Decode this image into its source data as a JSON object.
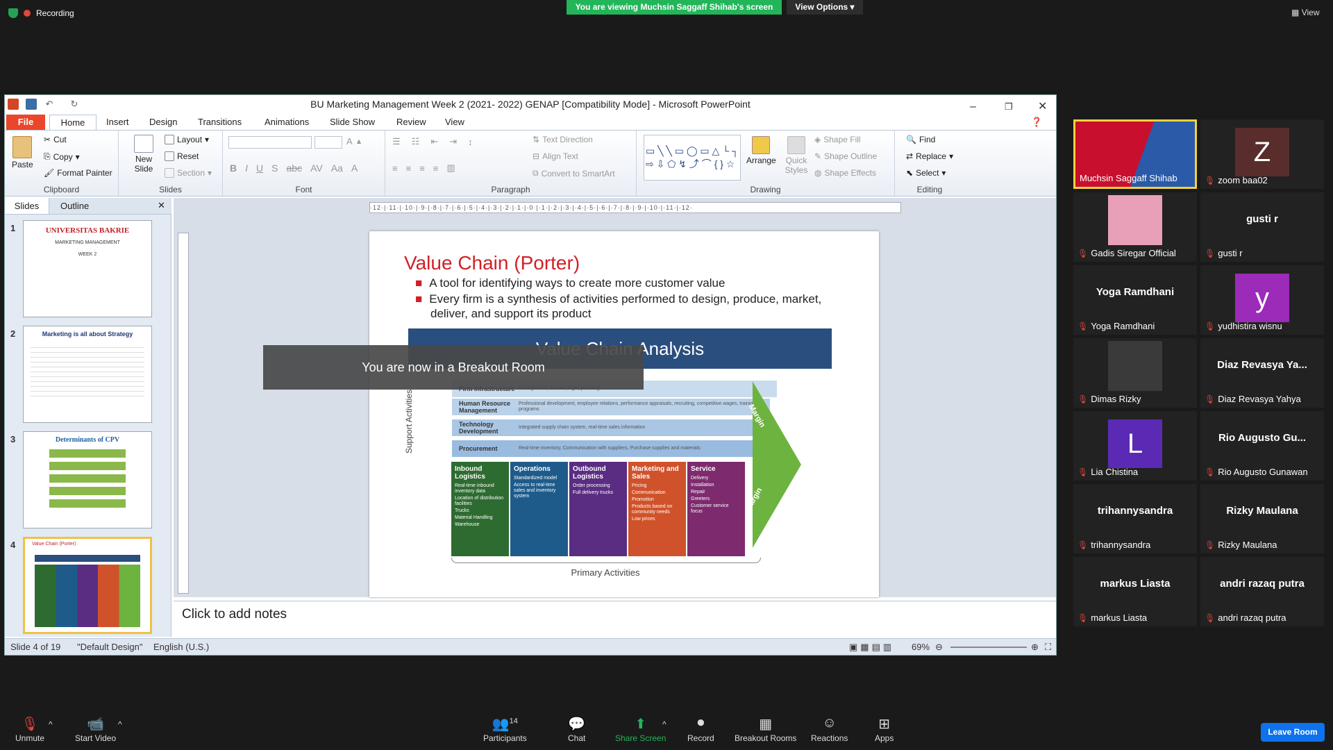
{
  "zoom_top": {
    "recording": "Recording",
    "viewing_banner": "You are viewing Muchsin Saggaff Shihab's screen",
    "view_options": "View Options",
    "view": "View"
  },
  "ppt": {
    "title": "BU Marketing Management Week 2 (2021- 2022) GENAP [Compatibility Mode]  -  Microsoft PowerPoint",
    "tabs": [
      "File",
      "Home",
      "Insert",
      "Design",
      "Transitions",
      "Animations",
      "Slide Show",
      "Review",
      "View"
    ],
    "ribbon": {
      "clipboard": {
        "label": "Clipboard",
        "paste": "Paste",
        "cut": "Cut",
        "copy": "Copy",
        "format_painter": "Format Painter"
      },
      "slides": {
        "label": "Slides",
        "new_slide": "New Slide",
        "layout": "Layout",
        "reset": "Reset",
        "section": "Section"
      },
      "font": {
        "label": "Font"
      },
      "paragraph": {
        "label": "Paragraph",
        "text_direction": "Text Direction",
        "align_text": "Align Text",
        "convert_smartart": "Convert to SmartArt"
      },
      "drawing": {
        "label": "Drawing",
        "arrange": "Arrange",
        "quick_styles": "Quick Styles",
        "shape_fill": "Shape Fill",
        "shape_outline": "Shape Outline",
        "shape_effects": "Shape Effects"
      },
      "editing": {
        "label": "Editing",
        "find": "Find",
        "replace": "Replace",
        "select": "Select"
      }
    },
    "pane_tabs": [
      "Slides",
      "Outline"
    ],
    "thumbs": [
      {
        "num": "1",
        "title": "UNIVERSITAS BAKRIE",
        "line1": "MARKETING MANAGEMENT",
        "line2": "WEEK 2"
      },
      {
        "num": "2",
        "title": "Marketing is all about Strategy"
      },
      {
        "num": "3",
        "title": "Determinants of CPV"
      },
      {
        "num": "4",
        "title": "Value Chain (Porter)"
      }
    ],
    "ruler": "·12·|·11·|·10·|·9·|·8·|·7·|·6·|·5·|·4·|·3·|·2·|·1·|·0·|·1·|·2·|·3·|·4·|·5·|·6·|·7·|·8·|·9·|·10·|·11·|·12·",
    "slide": {
      "title": "Value Chain (Porter)",
      "bullets": [
        "A tool for identifying ways to create more customer value",
        "Every firm is a synthesis of activities performed to design, produce, market, deliver, and support its product"
      ],
      "vca_title": "Value Chain Analysis",
      "support_label": "Support Activities",
      "support": [
        {
          "name": "Firm Infrastructure",
          "desc": "Management, finance, legal, planning"
        },
        {
          "name": "Human Resource Management",
          "desc": "Professional development, employee relations, performance appraisals, recruiting, competitive wages, training programs"
        },
        {
          "name": "Technology Development",
          "desc": "Integrated supply chain system, real-time sales information"
        },
        {
          "name": "Procurement",
          "desc": "Real-time inventory, Communication with suppliers, Purchase supplies and materials"
        }
      ],
      "primary": [
        {
          "name": "Inbound Logistics",
          "color": "#2e6b30",
          "items": [
            "Real-time inbound inventory data",
            "Location of distribution facilities",
            "Trucks",
            "Material Handling",
            "Warehouse"
          ]
        },
        {
          "name": "Operations",
          "color": "#1f5b8a",
          "items": [
            "Standardized model",
            "Access to real-time sales and inventory system"
          ]
        },
        {
          "name": "Outbound Logistics",
          "color": "#5a2d82",
          "items": [
            "Order processing",
            "Full delivery trucks"
          ]
        },
        {
          "name": "Marketing and Sales",
          "color": "#d0522a",
          "items": [
            "Pricing",
            "Communication",
            "Promotion",
            "Products based on community needs",
            "Low prices"
          ]
        },
        {
          "name": "Service",
          "color": "#7d2b6e",
          "items": [
            "Delivery",
            "Installation",
            "Repair",
            "Greeters",
            "Customer service focus"
          ]
        }
      ],
      "margin": "Margin",
      "primary_label": "Primary Activities"
    },
    "notes": "Click to add notes",
    "status": {
      "slide": "Slide 4 of 19",
      "design": "\"Default Design\"",
      "lang": "English (U.S.)",
      "zoom": "69%"
    }
  },
  "breakout_msg": "You are now in a Breakout Room",
  "participants": [
    {
      "name": "Muchsin Saggaff Shihab",
      "type": "video",
      "color": "#c8102e"
    },
    {
      "name": "zoom baa02",
      "type": "avatar",
      "letter": "Z",
      "color": "#5a2d2d"
    },
    {
      "name": "Gadis Siregar Official",
      "type": "photo",
      "color": "#e8a0b8"
    },
    {
      "name": "gusti r",
      "big": "gusti r",
      "type": "text"
    },
    {
      "name": "Yoga Ramdhani",
      "big": "Yoga Ramdhani",
      "type": "text"
    },
    {
      "name": "yudhistira wisnu",
      "type": "avatar",
      "letter": "y",
      "color": "#9b2bb8"
    },
    {
      "name": "Dimas Rizky",
      "type": "photo",
      "color": "#3a3a3a"
    },
    {
      "name": "Diaz Revasya Yahya",
      "big": "Diaz Revasya Ya...",
      "type": "text"
    },
    {
      "name": "Lia Chistina",
      "type": "avatar",
      "letter": "L",
      "color": "#5b2ab5"
    },
    {
      "name": "Rio Augusto Gunawan",
      "big": "Rio Augusto Gu...",
      "type": "text"
    },
    {
      "name": "trihannysandra",
      "big": "trihannysandra",
      "type": "text"
    },
    {
      "name": "Rizky Maulana",
      "big": "Rizky Maulana",
      "type": "text"
    },
    {
      "name": "markus Liasta",
      "big": "markus Liasta",
      "type": "text"
    },
    {
      "name": "andri razaq putra",
      "big": "andri razaq putra",
      "type": "text"
    }
  ],
  "toolbar": {
    "unmute": "Unmute",
    "start_video": "Start Video",
    "participants": "Participants",
    "participants_count": "14",
    "chat": "Chat",
    "share_screen": "Share Screen",
    "record": "Record",
    "breakout_rooms": "Breakout Rooms",
    "reactions": "Reactions",
    "apps": "Apps",
    "leave_room": "Leave Room"
  }
}
